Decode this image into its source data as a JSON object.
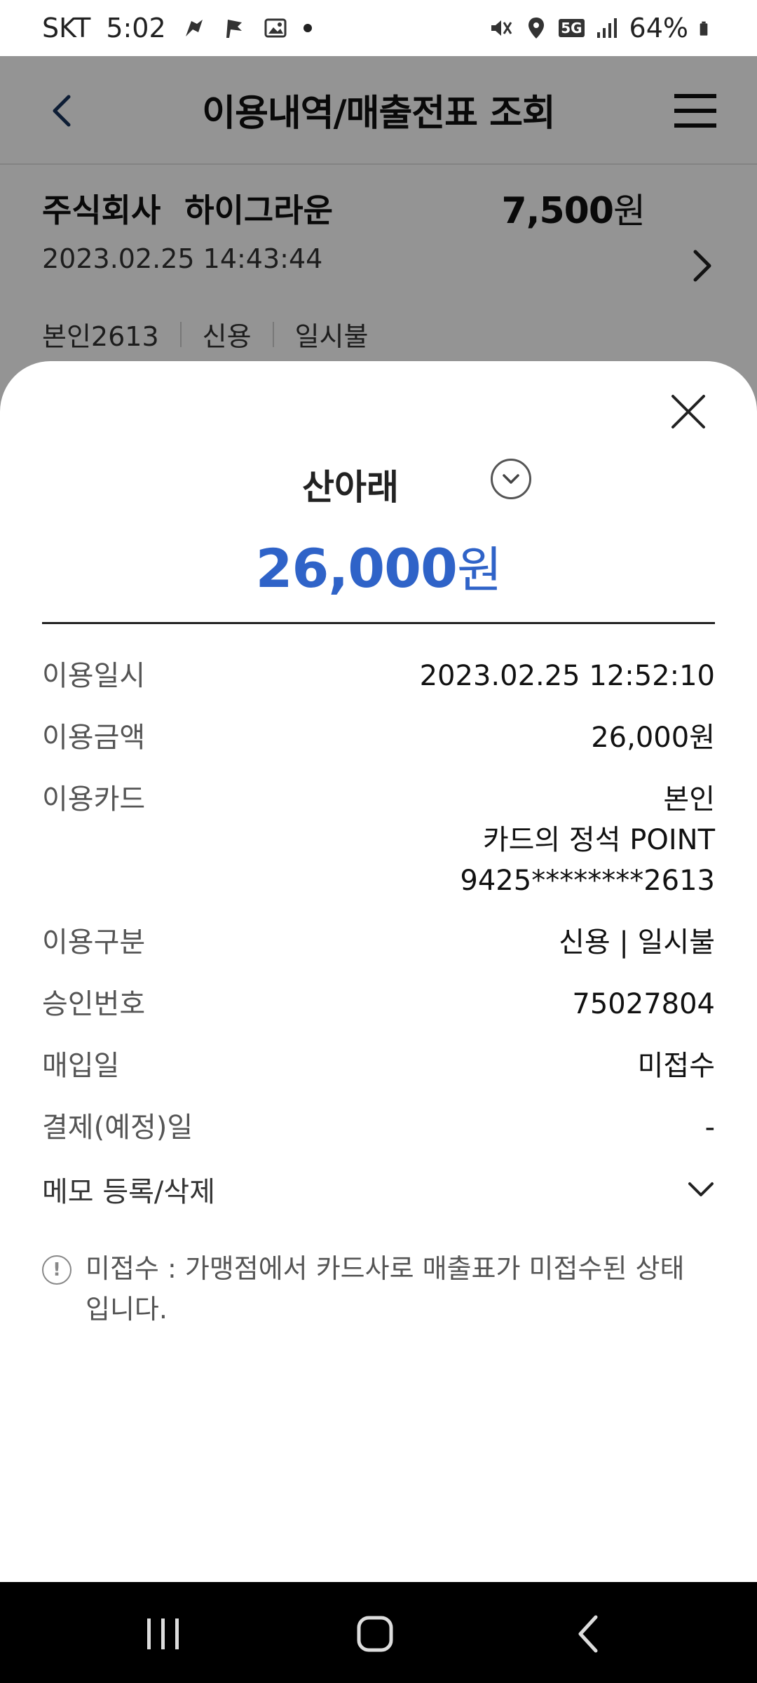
{
  "status_bar": {
    "carrier": "SKT",
    "time": "5:02",
    "battery": "64%",
    "network": "5G"
  },
  "header": {
    "title": "이용내역/매출전표 조회"
  },
  "background_txn": {
    "merchant": "주식회사 하이그라운",
    "amount": "7,500",
    "amount_unit": "원",
    "datetime": "2023.02.25 14:43:44",
    "card": "본인2613",
    "type": "신용",
    "installment": "일시불"
  },
  "sheet": {
    "merchant": "산아래",
    "amount": "26,000",
    "amount_unit": "원",
    "details": {
      "datetime_label": "이용일시",
      "datetime_value": "2023.02.25 12:52:10",
      "amount_label": "이용금액",
      "amount_value": "26,000원",
      "card_label": "이용카드",
      "card_owner": "본인",
      "card_name": "카드의 정석 POINT",
      "card_number": "9425********2613",
      "category_label": "이용구분",
      "category_value": "신용 | 일시불",
      "approval_label": "승인번호",
      "approval_value": "75027804",
      "purchase_label": "매입일",
      "purchase_value": "미접수",
      "payment_label": "결제(예정)일",
      "payment_value": "-",
      "memo_label": "메모 등록/삭제"
    },
    "notice": "미접수 : 가맹점에서 카드사로 매출표가 미접수된 상태 입니다."
  },
  "colors": {
    "accent": "#2f63c8",
    "overlay": "rgba(0,0,0,0.42)"
  }
}
